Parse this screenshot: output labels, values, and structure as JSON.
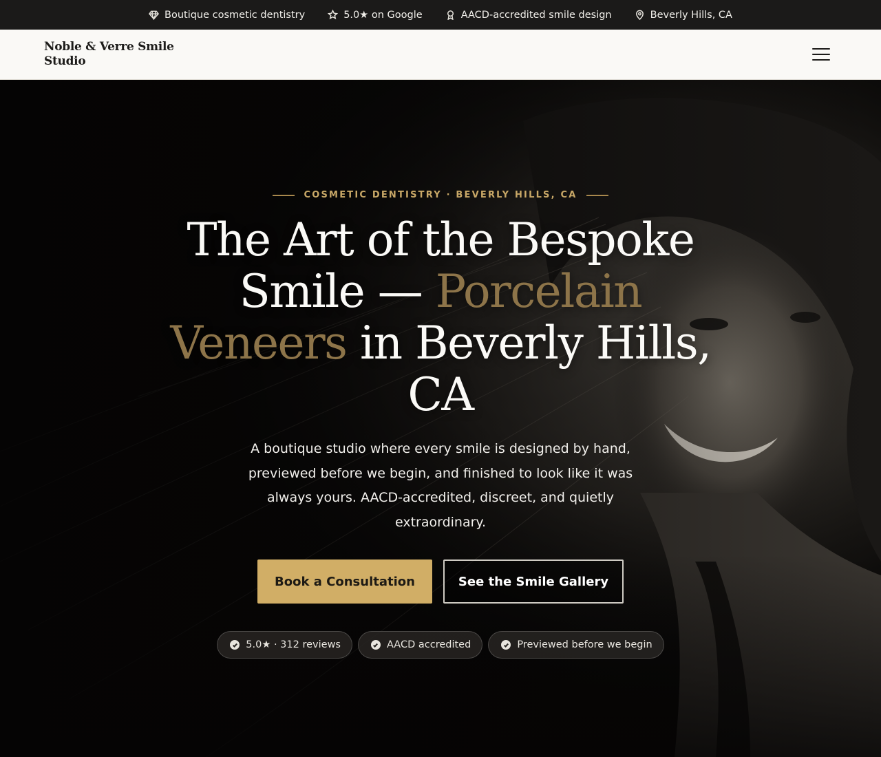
{
  "topbar": {
    "items": [
      {
        "icon": "diamond-icon",
        "label": "Boutique cosmetic dentistry"
      },
      {
        "icon": "star-icon",
        "label": "5.0★ on Google"
      },
      {
        "icon": "award-icon",
        "label": "AACD-accredited smile design"
      },
      {
        "icon": "map-pin-icon",
        "label": "Beverly Hills, CA"
      }
    ]
  },
  "header": {
    "brand": "Noble & Verre Smile Studio",
    "menu_icon": "hamburger-menu-icon"
  },
  "hero": {
    "eyebrow": "COSMETIC DENTISTRY · BEVERLY HILLS, CA",
    "headline_part1": "The Art of the Bespoke Smile — ",
    "headline_accent": "Porcelain Veneers",
    "headline_part2": " in Beverly Hills, CA",
    "subtext": "A boutique studio where every smile is designed by hand, previewed before we begin, and finished to look like it was always yours. AACD-accredited, discreet, and quietly extraordinary.",
    "primary_cta": "Book a Consultation",
    "secondary_cta": "See the Smile Gallery",
    "chips": [
      "5.0★ · 312 reviews",
      "AACD accredited",
      "Previewed before we begin"
    ]
  },
  "colors": {
    "accent_gold": "#d1ae66",
    "headline_accent": "#8d7449",
    "eyebrow": "#c9a867",
    "topbar_bg": "#1b1a19",
    "header_bg": "#faf9f6"
  }
}
